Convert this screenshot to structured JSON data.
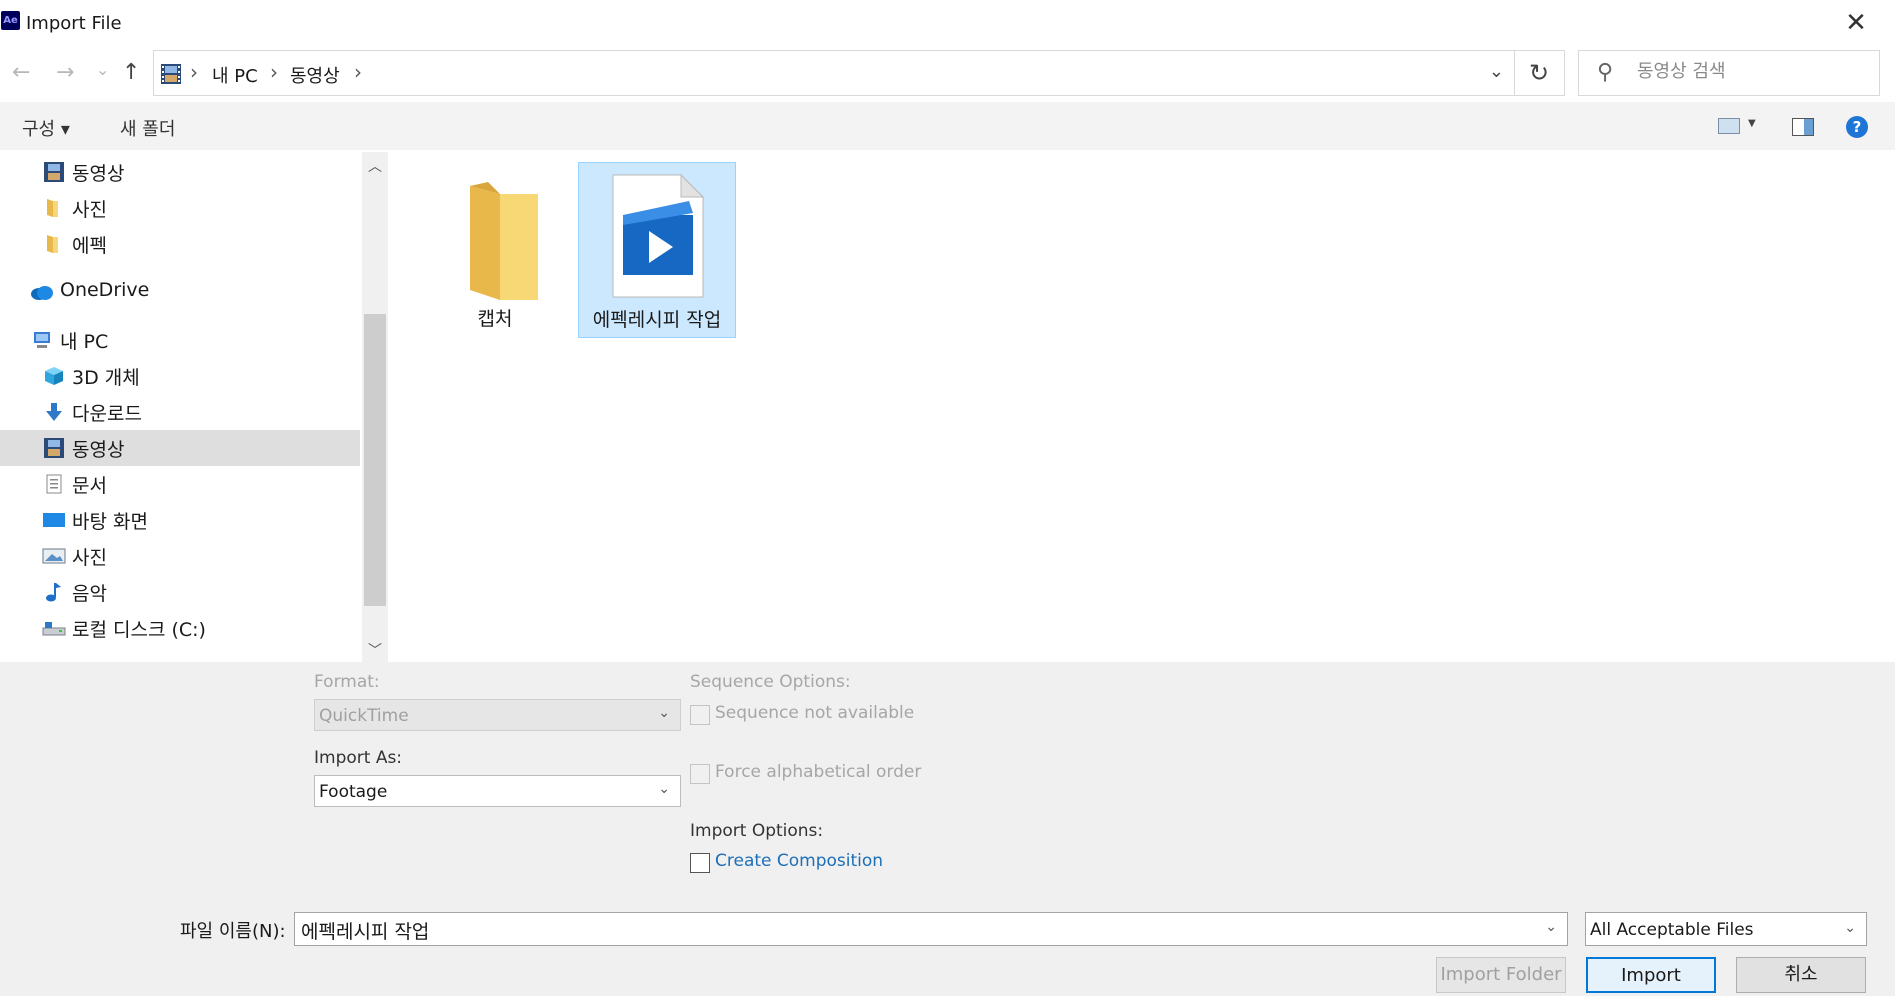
{
  "window": {
    "app_badge": "Ae",
    "title": "Import File",
    "close_glyph": "✕"
  },
  "address": {
    "back_glyph": "←",
    "forward_glyph": "→",
    "history_glyph": "⌄",
    "up_glyph": "↑",
    "breadcrumbs": [
      "내 PC",
      "동영상"
    ],
    "separator": "›",
    "dropdown_glyph": "⌄",
    "refresh_glyph": "↻",
    "search_placeholder": "동영상 검색"
  },
  "toolbar": {
    "organize_label": "구성 ▾",
    "new_folder_label": "새 폴더",
    "help_glyph": "?"
  },
  "nav_pane": {
    "items": [
      {
        "label": "동영상",
        "icon": "film-icon"
      },
      {
        "label": "사진",
        "icon": "folder-icon"
      },
      {
        "label": "에펙",
        "icon": "folder-icon"
      },
      {
        "label": "OneDrive",
        "icon": "cloud-icon"
      },
      {
        "label": "내 PC",
        "icon": "computer-icon"
      },
      {
        "label": "3D 개체",
        "icon": "cube-icon"
      },
      {
        "label": "다운로드",
        "icon": "download-icon"
      },
      {
        "label": "동영상",
        "icon": "film-icon",
        "selected": true
      },
      {
        "label": "문서",
        "icon": "document-icon"
      },
      {
        "label": "바탕 화면",
        "icon": "desktop-icon"
      },
      {
        "label": "사진",
        "icon": "pictures-icon"
      },
      {
        "label": "음악",
        "icon": "music-icon"
      },
      {
        "label": "로컬 디스크 (C:)",
        "icon": "drive-icon"
      }
    ],
    "scroll_up_glyph": "︿",
    "scroll_down_glyph": "﹀"
  },
  "files": [
    {
      "name": "캡처",
      "type": "folder",
      "selected": false
    },
    {
      "name": "에펙레시피 작업",
      "type": "video",
      "selected": true
    }
  ],
  "options": {
    "format_label": "Format:",
    "format_value": "QuickTime",
    "import_as_label": "Import As:",
    "import_as_value": "Footage",
    "sequence_label": "Sequence Options:",
    "sequence_checkbox": "Sequence not available",
    "force_alpha_checkbox": "Force alphabetical order",
    "import_options_label": "Import Options:",
    "create_comp_checkbox": "Create Composition",
    "chevron_glyph": "⌄"
  },
  "footer": {
    "filename_label": "파일 이름(N):",
    "filename_value": "에펙레시피 작업",
    "filter_value": "All Acceptable Files",
    "import_folder_label": "Import Folder",
    "import_label": "Import",
    "cancel_label": "취소"
  }
}
